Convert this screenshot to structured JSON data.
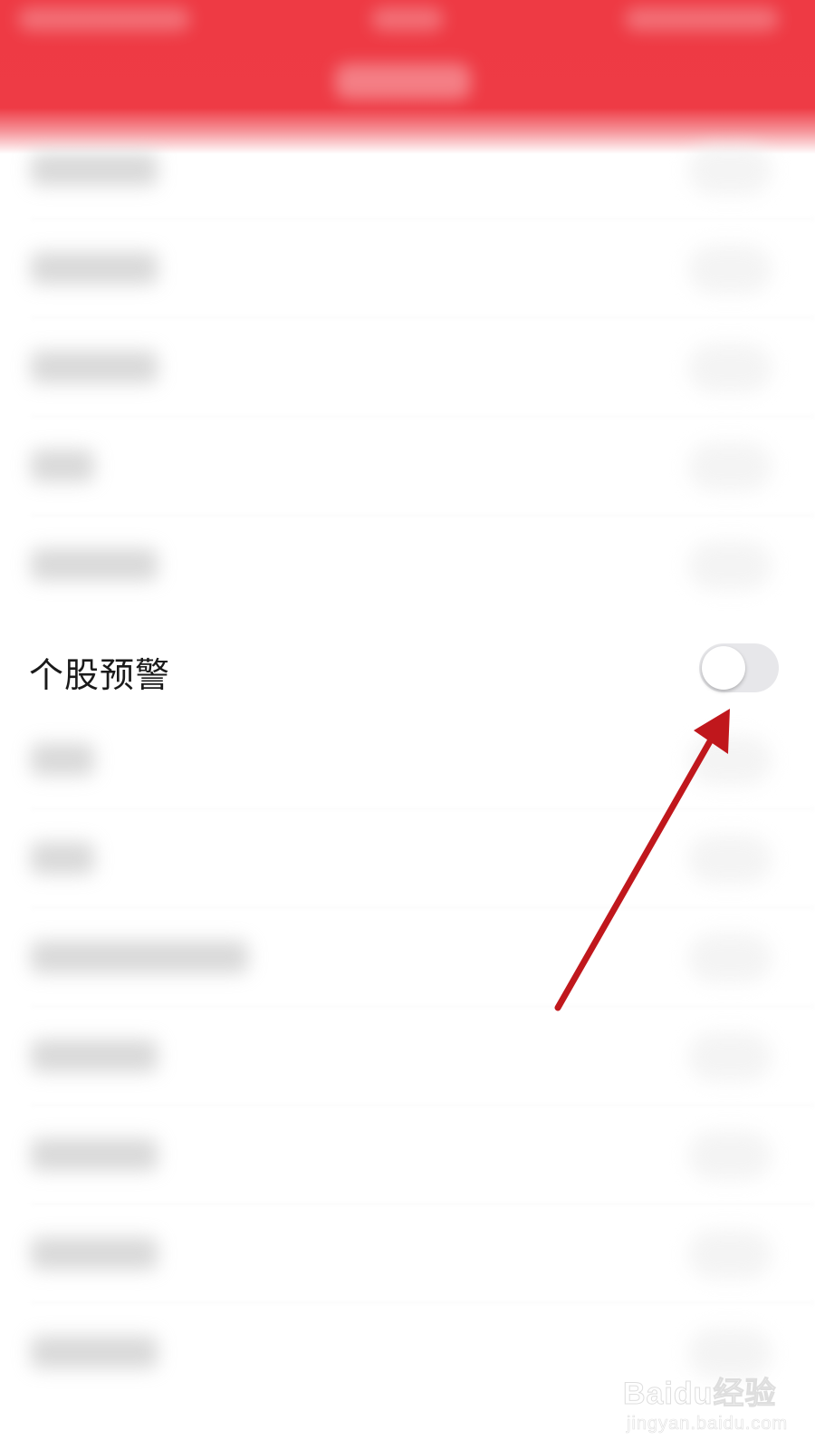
{
  "header": {
    "background_color": "#ee3b45"
  },
  "settings": {
    "focus_item": {
      "label": "个股预警",
      "toggle_on": false
    }
  },
  "annotation": {
    "arrow_color": "#c0171c"
  },
  "watermark": {
    "main_text": "Baidu经验",
    "sub_text": "jingyan.baidu.com"
  }
}
